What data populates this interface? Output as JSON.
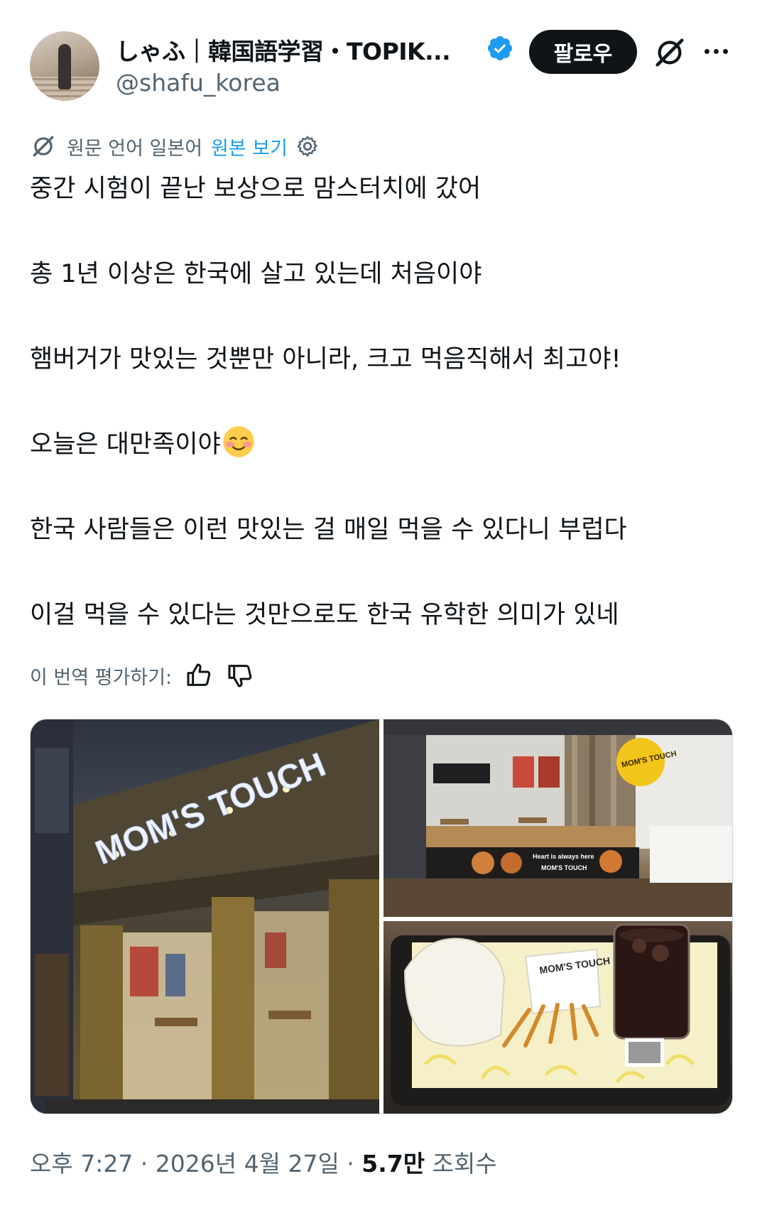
{
  "author": {
    "display_name": "しゃふ｜韓国語学習・TOPIK...",
    "handle": "@shafu_korea",
    "verified": true
  },
  "follow_label": "팔로우",
  "translation": {
    "notice": "원문 언어 일본어",
    "show_original": "원본 보기"
  },
  "tweet": {
    "paragraphs": [
      "중간 시험이 끝난 보상으로 맘스터치에 갔어",
      "총 1년 이상은 한국에 살고 있는데 처음이야",
      "햄버거가 맛있는 것뿐만 아니라, 크고 먹음직해서 최고야!",
      "오늘은 대만족이야",
      "한국 사람들은 이런 맛있는 걸 매일 먹을 수 있다니 부럽다",
      "이걸 먹을 수 있다는 것만으로도 한국 유학한 의미가 있네"
    ]
  },
  "rate_translation": "이 번역 평가하기:",
  "media": {
    "store_sign": "MOM'S TOUCH",
    "interior_logo": "MOM'S TOUCH",
    "banner_text": "Heart is always here",
    "banner_brand": "MOM'S TOUCH",
    "bag_text": "MOM'S TOUCH"
  },
  "meta": {
    "timestamp": "오후 7:27 · 2026년 4월 27일 · ",
    "views_count": "5.7만",
    "views_label": " 조회수"
  },
  "colors": {
    "text": "#0f1419",
    "secondary": "#536471",
    "link": "#1d9bf0",
    "verified": "#1d9bf0"
  },
  "icons": [
    "verified-badge-icon",
    "grok-icon",
    "more-icon",
    "language-icon",
    "gear-icon",
    "thumbs-up-icon",
    "thumbs-down-icon",
    "smiling-face-emoji"
  ]
}
